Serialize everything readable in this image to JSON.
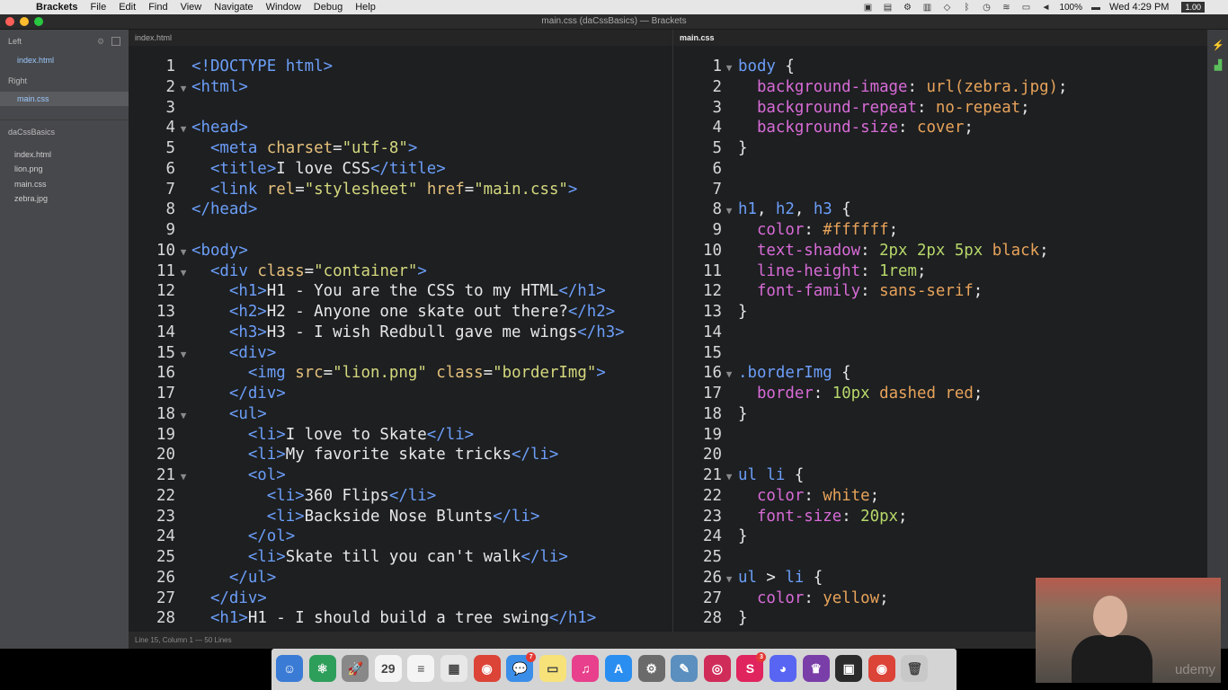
{
  "menubar": {
    "app": "Brackets",
    "items": [
      "File",
      "Edit",
      "Find",
      "View",
      "Navigate",
      "Window",
      "Debug",
      "Help"
    ],
    "clock": "Wed 4:29 PM",
    "battery": "100%",
    "zoom": "1.00"
  },
  "window": {
    "title": "main.css (daCssBasics) — Brackets"
  },
  "sidebar": {
    "left_label": "Left",
    "left_file": "index.html",
    "right_label": "Right",
    "right_file": "main.css",
    "project": "daCssBasics",
    "files": [
      "index.html",
      "lion.png",
      "main.css",
      "zebra.jpg"
    ]
  },
  "left_pane": {
    "tab": "index.html",
    "lines": [
      {
        "n": "1",
        "fold": false,
        "tokens": [
          [
            "t-tag",
            "<!DOCTYPE html>"
          ]
        ]
      },
      {
        "n": "2",
        "fold": true,
        "tokens": [
          [
            "t-tag",
            "<html>"
          ]
        ]
      },
      {
        "n": "3",
        "fold": false,
        "tokens": []
      },
      {
        "n": "4",
        "fold": true,
        "tokens": [
          [
            "t-tag",
            "<head>"
          ]
        ]
      },
      {
        "n": "5",
        "fold": false,
        "tokens": [
          [
            "t-txt",
            "  "
          ],
          [
            "t-tag",
            "<meta "
          ],
          [
            "t-attr",
            "charset"
          ],
          [
            "t-punc",
            "="
          ],
          [
            "t-str",
            "\"utf-8\""
          ],
          [
            "t-tag",
            ">"
          ]
        ]
      },
      {
        "n": "6",
        "fold": false,
        "tokens": [
          [
            "t-txt",
            "  "
          ],
          [
            "t-tag",
            "<title>"
          ],
          [
            "t-txt",
            "I love CSS"
          ],
          [
            "t-tag",
            "</title>"
          ]
        ]
      },
      {
        "n": "7",
        "fold": false,
        "tokens": [
          [
            "t-txt",
            "  "
          ],
          [
            "t-tag",
            "<link "
          ],
          [
            "t-attr",
            "rel"
          ],
          [
            "t-punc",
            "="
          ],
          [
            "t-str",
            "\"stylesheet\""
          ],
          [
            "t-txt",
            " "
          ],
          [
            "t-attr",
            "href"
          ],
          [
            "t-punc",
            "="
          ],
          [
            "t-str",
            "\"main.css\""
          ],
          [
            "t-tag",
            ">"
          ]
        ]
      },
      {
        "n": "8",
        "fold": false,
        "tokens": [
          [
            "t-tag",
            "</head>"
          ]
        ]
      },
      {
        "n": "9",
        "fold": false,
        "tokens": []
      },
      {
        "n": "10",
        "fold": true,
        "tokens": [
          [
            "t-tag",
            "<body>"
          ]
        ]
      },
      {
        "n": "11",
        "fold": true,
        "tokens": [
          [
            "t-txt",
            "  "
          ],
          [
            "t-tag",
            "<div "
          ],
          [
            "t-attr",
            "class"
          ],
          [
            "t-punc",
            "="
          ],
          [
            "t-str",
            "\"container\""
          ],
          [
            "t-tag",
            ">"
          ]
        ]
      },
      {
        "n": "12",
        "fold": false,
        "tokens": [
          [
            "t-txt",
            "    "
          ],
          [
            "t-tag",
            "<h1>"
          ],
          [
            "t-txt",
            "H1 - You are the CSS to my HTML"
          ],
          [
            "t-tag",
            "</h1>"
          ]
        ]
      },
      {
        "n": "13",
        "fold": false,
        "tokens": [
          [
            "t-txt",
            "    "
          ],
          [
            "t-tag",
            "<h2>"
          ],
          [
            "t-txt",
            "H2 - Anyone one skate out there?"
          ],
          [
            "t-tag",
            "</h2>"
          ]
        ]
      },
      {
        "n": "14",
        "fold": false,
        "tokens": [
          [
            "t-txt",
            "    "
          ],
          [
            "t-tag",
            "<h3>"
          ],
          [
            "t-txt",
            "H3 - I wish Redbull gave me wings"
          ],
          [
            "t-tag",
            "</h3>"
          ]
        ]
      },
      {
        "n": "15",
        "fold": true,
        "tokens": [
          [
            "t-txt",
            "    "
          ],
          [
            "t-tag",
            "<div>"
          ]
        ]
      },
      {
        "n": "16",
        "fold": false,
        "tokens": [
          [
            "t-txt",
            "      "
          ],
          [
            "t-tag",
            "<img "
          ],
          [
            "t-attr",
            "src"
          ],
          [
            "t-punc",
            "="
          ],
          [
            "t-str",
            "\"lion.png\""
          ],
          [
            "t-txt",
            " "
          ],
          [
            "t-attr",
            "class"
          ],
          [
            "t-punc",
            "="
          ],
          [
            "t-str",
            "\"borderImg\""
          ],
          [
            "t-tag",
            ">"
          ]
        ]
      },
      {
        "n": "17",
        "fold": false,
        "tokens": [
          [
            "t-txt",
            "    "
          ],
          [
            "t-tag",
            "</div>"
          ]
        ]
      },
      {
        "n": "18",
        "fold": true,
        "tokens": [
          [
            "t-txt",
            "    "
          ],
          [
            "t-tag",
            "<ul>"
          ]
        ]
      },
      {
        "n": "19",
        "fold": false,
        "tokens": [
          [
            "t-txt",
            "      "
          ],
          [
            "t-tag",
            "<li>"
          ],
          [
            "t-txt",
            "I love to Skate"
          ],
          [
            "t-tag",
            "</li>"
          ]
        ]
      },
      {
        "n": "20",
        "fold": false,
        "tokens": [
          [
            "t-txt",
            "      "
          ],
          [
            "t-tag",
            "<li>"
          ],
          [
            "t-txt",
            "My favorite skate tricks"
          ],
          [
            "t-tag",
            "</li>"
          ]
        ]
      },
      {
        "n": "21",
        "fold": true,
        "tokens": [
          [
            "t-txt",
            "      "
          ],
          [
            "t-tag",
            "<ol>"
          ]
        ]
      },
      {
        "n": "22",
        "fold": false,
        "tokens": [
          [
            "t-txt",
            "        "
          ],
          [
            "t-tag",
            "<li>"
          ],
          [
            "t-txt",
            "360 Flips"
          ],
          [
            "t-tag",
            "</li>"
          ]
        ]
      },
      {
        "n": "23",
        "fold": false,
        "tokens": [
          [
            "t-txt",
            "        "
          ],
          [
            "t-tag",
            "<li>"
          ],
          [
            "t-txt",
            "Backside Nose Blunts"
          ],
          [
            "t-tag",
            "</li>"
          ]
        ]
      },
      {
        "n": "24",
        "fold": false,
        "tokens": [
          [
            "t-txt",
            "      "
          ],
          [
            "t-tag",
            "</ol>"
          ]
        ]
      },
      {
        "n": "25",
        "fold": false,
        "tokens": [
          [
            "t-txt",
            "      "
          ],
          [
            "t-tag",
            "<li>"
          ],
          [
            "t-txt",
            "Skate till you can't walk"
          ],
          [
            "t-tag",
            "</li>"
          ]
        ]
      },
      {
        "n": "26",
        "fold": false,
        "tokens": [
          [
            "t-txt",
            "    "
          ],
          [
            "t-tag",
            "</ul>"
          ]
        ]
      },
      {
        "n": "27",
        "fold": false,
        "tokens": [
          [
            "t-txt",
            "  "
          ],
          [
            "t-tag",
            "</div>"
          ]
        ]
      },
      {
        "n": "28",
        "fold": false,
        "tokens": [
          [
            "t-txt",
            "  "
          ],
          [
            "t-tag",
            "<h1>"
          ],
          [
            "t-txt",
            "H1 - I should build a tree swing"
          ],
          [
            "t-tag",
            "</h1>"
          ]
        ]
      }
    ]
  },
  "right_pane": {
    "tab": "main.css",
    "lines": [
      {
        "n": "1",
        "fold": true,
        "tokens": [
          [
            "t-sel",
            "body"
          ],
          [
            "t-punc",
            " {"
          ]
        ]
      },
      {
        "n": "2",
        "fold": false,
        "tokens": [
          [
            "t-txt",
            "  "
          ],
          [
            "t-prop",
            "background-image"
          ],
          [
            "t-punc",
            ": "
          ],
          [
            "t-val",
            "url(zebra.jpg)"
          ],
          [
            "t-punc",
            ";"
          ]
        ]
      },
      {
        "n": "3",
        "fold": false,
        "tokens": [
          [
            "t-txt",
            "  "
          ],
          [
            "t-prop",
            "background-repeat"
          ],
          [
            "t-punc",
            ": "
          ],
          [
            "t-val",
            "no-repeat"
          ],
          [
            "t-punc",
            ";"
          ]
        ]
      },
      {
        "n": "4",
        "fold": false,
        "tokens": [
          [
            "t-txt",
            "  "
          ],
          [
            "t-prop",
            "background-size"
          ],
          [
            "t-punc",
            ": "
          ],
          [
            "t-val",
            "cover"
          ],
          [
            "t-punc",
            ";"
          ]
        ]
      },
      {
        "n": "5",
        "fold": false,
        "tokens": [
          [
            "t-punc",
            "}"
          ]
        ]
      },
      {
        "n": "6",
        "fold": false,
        "tokens": []
      },
      {
        "n": "7",
        "fold": false,
        "tokens": []
      },
      {
        "n": "8",
        "fold": true,
        "tokens": [
          [
            "t-sel",
            "h1"
          ],
          [
            "t-punc",
            ", "
          ],
          [
            "t-sel",
            "h2"
          ],
          [
            "t-punc",
            ", "
          ],
          [
            "t-sel",
            "h3"
          ],
          [
            "t-punc",
            " {"
          ]
        ]
      },
      {
        "n": "9",
        "fold": false,
        "tokens": [
          [
            "t-txt",
            "  "
          ],
          [
            "t-prop",
            "color"
          ],
          [
            "t-punc",
            ": "
          ],
          [
            "t-val",
            "#ffffff"
          ],
          [
            "t-punc",
            ";"
          ]
        ]
      },
      {
        "n": "10",
        "fold": false,
        "tokens": [
          [
            "t-txt",
            "  "
          ],
          [
            "t-prop",
            "text-shadow"
          ],
          [
            "t-punc",
            ": "
          ],
          [
            "t-num",
            "2px 2px 5px"
          ],
          [
            "t-txt",
            " "
          ],
          [
            "t-val",
            "black"
          ],
          [
            "t-punc",
            ";"
          ]
        ]
      },
      {
        "n": "11",
        "fold": false,
        "tokens": [
          [
            "t-txt",
            "  "
          ],
          [
            "t-prop",
            "line-height"
          ],
          [
            "t-punc",
            ": "
          ],
          [
            "t-num",
            "1rem"
          ],
          [
            "t-punc",
            ";"
          ]
        ]
      },
      {
        "n": "12",
        "fold": false,
        "tokens": [
          [
            "t-txt",
            "  "
          ],
          [
            "t-prop",
            "font-family"
          ],
          [
            "t-punc",
            ": "
          ],
          [
            "t-val",
            "sans-serif"
          ],
          [
            "t-punc",
            ";"
          ]
        ]
      },
      {
        "n": "13",
        "fold": false,
        "tokens": [
          [
            "t-punc",
            "}"
          ]
        ]
      },
      {
        "n": "14",
        "fold": false,
        "tokens": []
      },
      {
        "n": "15",
        "fold": false,
        "tokens": []
      },
      {
        "n": "16",
        "fold": true,
        "tokens": [
          [
            "t-cls",
            ".borderImg"
          ],
          [
            "t-punc",
            " {"
          ]
        ]
      },
      {
        "n": "17",
        "fold": false,
        "tokens": [
          [
            "t-txt",
            "  "
          ],
          [
            "t-prop",
            "border"
          ],
          [
            "t-punc",
            ": "
          ],
          [
            "t-num",
            "10px"
          ],
          [
            "t-txt",
            " "
          ],
          [
            "t-val",
            "dashed red"
          ],
          [
            "t-punc",
            ";"
          ]
        ]
      },
      {
        "n": "18",
        "fold": false,
        "tokens": [
          [
            "t-punc",
            "}"
          ]
        ]
      },
      {
        "n": "19",
        "fold": false,
        "tokens": []
      },
      {
        "n": "20",
        "fold": false,
        "tokens": []
      },
      {
        "n": "21",
        "fold": true,
        "tokens": [
          [
            "t-sel",
            "ul li"
          ],
          [
            "t-punc",
            " {"
          ]
        ]
      },
      {
        "n": "22",
        "fold": false,
        "tokens": [
          [
            "t-txt",
            "  "
          ],
          [
            "t-prop",
            "color"
          ],
          [
            "t-punc",
            ": "
          ],
          [
            "t-val",
            "white"
          ],
          [
            "t-punc",
            ";"
          ]
        ]
      },
      {
        "n": "23",
        "fold": false,
        "tokens": [
          [
            "t-txt",
            "  "
          ],
          [
            "t-prop",
            "font-size"
          ],
          [
            "t-punc",
            ": "
          ],
          [
            "t-num",
            "20px"
          ],
          [
            "t-punc",
            ";"
          ]
        ]
      },
      {
        "n": "24",
        "fold": false,
        "tokens": [
          [
            "t-punc",
            "}"
          ]
        ]
      },
      {
        "n": "25",
        "fold": false,
        "tokens": []
      },
      {
        "n": "26",
        "fold": true,
        "tokens": [
          [
            "t-sel",
            "ul"
          ],
          [
            "t-punc",
            " > "
          ],
          [
            "t-sel",
            "li"
          ],
          [
            "t-punc",
            " {"
          ]
        ]
      },
      {
        "n": "27",
        "fold": false,
        "tokens": [
          [
            "t-txt",
            "  "
          ],
          [
            "t-prop",
            "color"
          ],
          [
            "t-punc",
            ": "
          ],
          [
            "t-val",
            "yellow"
          ],
          [
            "t-punc",
            ";"
          ]
        ]
      },
      {
        "n": "28",
        "fold": false,
        "tokens": [
          [
            "t-punc",
            "}"
          ]
        ]
      }
    ]
  },
  "statusbar": {
    "text": "Line 15, Column 1 — 50 Lines"
  },
  "dock": {
    "icons": [
      {
        "name": "finder-icon",
        "color": "#3a7bd5",
        "glyph": "☺"
      },
      {
        "name": "atom-icon",
        "color": "#2e9e5b",
        "glyph": "⚛"
      },
      {
        "name": "launchpad-icon",
        "color": "#888888",
        "glyph": "🚀"
      },
      {
        "name": "calendar-icon",
        "color": "#f4f4f4",
        "glyph": "29"
      },
      {
        "name": "reminders-icon",
        "color": "#f4f4f4",
        "glyph": "≡"
      },
      {
        "name": "grid-icon",
        "color": "#e8e8e8",
        "glyph": "▦"
      },
      {
        "name": "chrome-icon",
        "color": "#db4437",
        "glyph": "◉"
      },
      {
        "name": "messages-icon",
        "color": "#3b8ee8",
        "glyph": "💬",
        "badge": "7"
      },
      {
        "name": "notes-icon",
        "color": "#f7e27a",
        "glyph": "▭"
      },
      {
        "name": "itunes-icon",
        "color": "#e8408c",
        "glyph": "♫"
      },
      {
        "name": "app-store-icon",
        "color": "#2a8ef0",
        "glyph": "A"
      },
      {
        "name": "system-preferences-icon",
        "color": "#6b6b6b",
        "glyph": "⚙"
      },
      {
        "name": "preview-icon",
        "color": "#5a8fbf",
        "glyph": "✎"
      },
      {
        "name": "photo-booth-icon",
        "color": "#d02c5a",
        "glyph": "◎"
      },
      {
        "name": "slack-icon",
        "color": "#e0245e",
        "glyph": "S",
        "badge": "3"
      },
      {
        "name": "discord-icon",
        "color": "#5865f2",
        "glyph": "◕"
      },
      {
        "name": "game-icon",
        "color": "#7a3ea8",
        "glyph": "♛"
      },
      {
        "name": "brackets-icon",
        "color": "#2b2b2b",
        "glyph": "▣"
      },
      {
        "name": "chrome-2-icon",
        "color": "#db4437",
        "glyph": "◉"
      },
      {
        "name": "trash-icon",
        "color": "#c8c8c8",
        "glyph": "🗑"
      }
    ]
  },
  "webcam": {
    "watermark": "udemy"
  }
}
